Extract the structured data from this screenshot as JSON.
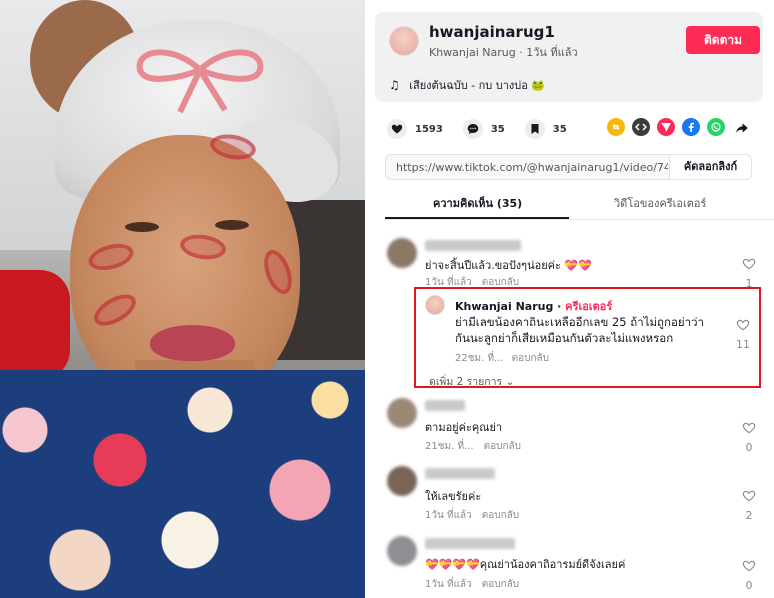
{
  "post": {
    "author_username": "hwanjainarug1",
    "author_display": "Khwanjai Narug",
    "posted_ago": "1วัน ที่แล้ว",
    "follow_label": "ติดตาม",
    "music": "เสียงต้นฉบับ - กบ บางบ่อ 🐸"
  },
  "stats": {
    "likes": "1593",
    "comments": "35",
    "saves": "35"
  },
  "share_icons": [
    "repost-icon",
    "embed-icon",
    "send-icon",
    "facebook-icon",
    "whatsapp-icon",
    "share-arrow-icon"
  ],
  "colors": {
    "accent": "#fe2c55",
    "highlight_box": "#e0171f",
    "repost": "#f5b80b",
    "facebook": "#1877f2",
    "whatsapp": "#25d366",
    "send": "#fe2c55",
    "embed": "#3c3c3c"
  },
  "link": {
    "url": "https://www.tiktok.com/@hwanjainarug1/video/7440...",
    "copy_label": "คัดลอกลิงก์"
  },
  "tabs": {
    "comments": "ความคิดเห็น (35)",
    "creator_videos": "วิดีโอของครีเอเตอร์"
  },
  "comments": [
    {
      "text": "ย่าจะสิ้นปีแล้ว.ขอปังๆน่อยค่ะ 💝💝",
      "time": "1วัน ที่แล้ว",
      "reply_label": "ตอบกลับ",
      "likes": "1"
    },
    {
      "text": "ตามอยู่ค่ะคุณย่า",
      "time": "21ชม. ที่...",
      "reply_label": "ตอบกลับ",
      "likes": "0"
    },
    {
      "text": "ให้เลขรัยค่ะ",
      "time": "1วัน ที่แล้ว",
      "reply_label": "ตอบกลับ",
      "likes": "2"
    },
    {
      "text": "💝💝💝💝คุณย่าน้องคาถิอารมย์ดีจังเลยค่",
      "time": "1วัน ที่แล้ว",
      "reply_label": "ตอบกลับ",
      "likes": "0"
    }
  ],
  "creator_reply": {
    "name": "Khwanjai Narug",
    "badge": "ครีเอเตอร์",
    "line1": "ย่ามีเลขน้องคาถินะเหลืออีกเลข 25 ถ้าไม่ถูกอย่าว่า",
    "line2": "กันนะลูกย่าก็เสียเหมือนกันตัวละไม่แพงหรอก",
    "time": "22ชม. ที่...",
    "reply_label": "ตอบกลับ",
    "likes": "11",
    "more_replies": "ดูเพิ่ม 2 รายการ"
  }
}
